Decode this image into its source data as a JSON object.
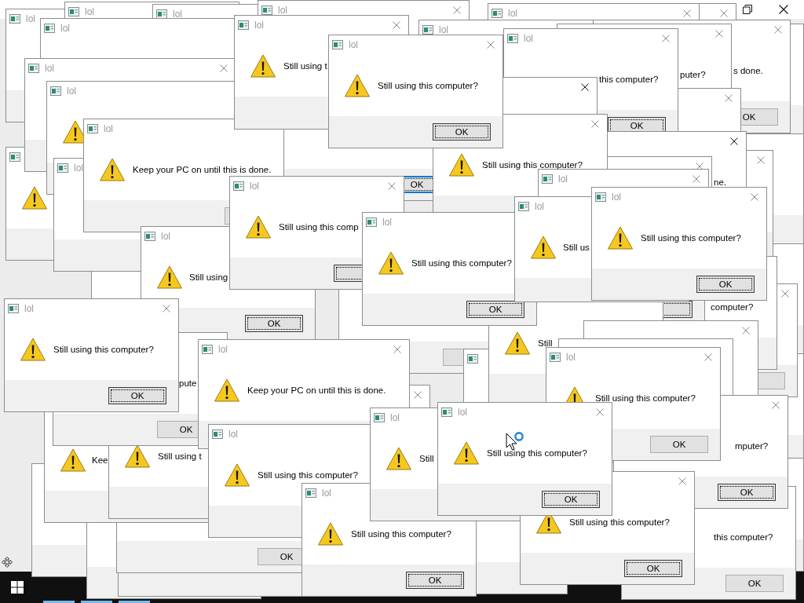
{
  "app_window": {
    "maximized": true
  },
  "cursor": {
    "busy": true
  },
  "dialogs": [
    {
      "title": "lol"
    },
    {
      "title": "lol"
    },
    {
      "title": "lol"
    },
    {
      "title": "lol",
      "active": false
    },
    {
      "title": "lol",
      "active": false
    },
    {
      "active": false
    },
    {
      "title": "lol"
    },
    {
      "title": "lol",
      "active": false,
      "message": "Still using t"
    },
    {
      "title": "lol"
    },
    {
      "active": false,
      "message": "puter?"
    },
    {
      "active": false,
      "message": "s done.",
      "button": {
        "label": "OK",
        "focused": false,
        "active": false
      }
    },
    {
      "title": "lol",
      "active": false,
      "message": "Still using this computer?",
      "button": {
        "label": "OK",
        "focused": true,
        "active": false
      }
    },
    {
      "title": "lol",
      "active": false,
      "message": "this computer?",
      "button": {
        "label": "OK",
        "focused": true,
        "active": false
      }
    },
    {
      "title": "lol",
      "active": false
    },
    {
      "title": "lol"
    },
    {
      "active": true
    },
    {
      "active": false
    },
    {
      "title": "lol",
      "message": "Keep your PC on until this is done.",
      "button": {
        "focused": false,
        "active": false
      }
    },
    {
      "message": "Still using this computer?"
    },
    {
      "active": true,
      "message": "ne."
    },
    {
      "title": "lol"
    },
    {
      "active": false
    },
    {
      "active": false
    },
    {
      "title": "lol",
      "active": false,
      "message": "Still using this comp",
      "button": {
        "focused": true,
        "active": false
      }
    },
    {
      "button": {
        "label": "OK",
        "focused": true,
        "active": true
      }
    },
    {
      "title": "lol",
      "active": false
    },
    {
      "title": "lol",
      "message": "Still us"
    },
    {
      "title": "lol",
      "active": false,
      "message": "Still using this computer?",
      "button": {
        "label": "OK",
        "focused": true,
        "active": false
      }
    },
    {
      "title": "lol",
      "message": "Still using",
      "button": {
        "label": "OK",
        "focused": true,
        "active": false
      }
    },
    {
      "title": "lol",
      "message": "Still using this computer?",
      "button": {
        "label": "OK",
        "focused": true,
        "active": false
      }
    },
    {
      "title": "lol",
      "active": false,
      "message": "Still using this computer?",
      "button": {
        "label": "OK",
        "focused": true,
        "active": false
      }
    },
    {
      "button": {
        "focused": true,
        "active": false
      }
    },
    {
      "message": "computer?"
    },
    {
      "active": false,
      "button": {
        "focused": false,
        "active": false
      }
    },
    {
      "message": "Still"
    },
    {
      "active": false
    },
    {
      "title": "lol",
      "active": false,
      "message": "Keep your PC on until this is done."
    },
    {
      "button": {
        "focused": false,
        "active": false
      }
    },
    {
      "title": "lol",
      "active": false,
      "message": "Still using this computer?",
      "button": {
        "label": "OK",
        "focused": false,
        "active": false
      }
    },
    {
      "message": "pute",
      "button": {
        "label": "OK",
        "focused": false,
        "active": false
      }
    },
    {
      "active": false
    },
    {
      "title": "lol",
      "message": "Still"
    },
    {
      "title": "lol",
      "active": false,
      "message": "Still using this computer?",
      "button": {
        "label": "OK",
        "focused": true,
        "active": false
      }
    },
    {
      "active": false,
      "message": "mputer?",
      "button": {
        "label": "OK",
        "focused": true,
        "active": false
      }
    },
    {
      "message": "Kee"
    },
    {
      "message": "Still using t"
    },
    {
      "title": "lol",
      "message": "Still using this computer?"
    },
    {
      "title": "lol",
      "message": "Still using this computer?",
      "button": {
        "label": "OK",
        "focused": true,
        "active": false
      }
    },
    {
      "active": false,
      "message": "Still using this computer?",
      "button": {
        "label": "OK",
        "focused": true,
        "active": false
      }
    },
    {
      "button": {
        "label": "OK",
        "focused": false,
        "active": false
      }
    },
    {
      "message": "this computer?",
      "button": {
        "label": "OK",
        "focused": false,
        "active": false
      }
    }
  ]
}
